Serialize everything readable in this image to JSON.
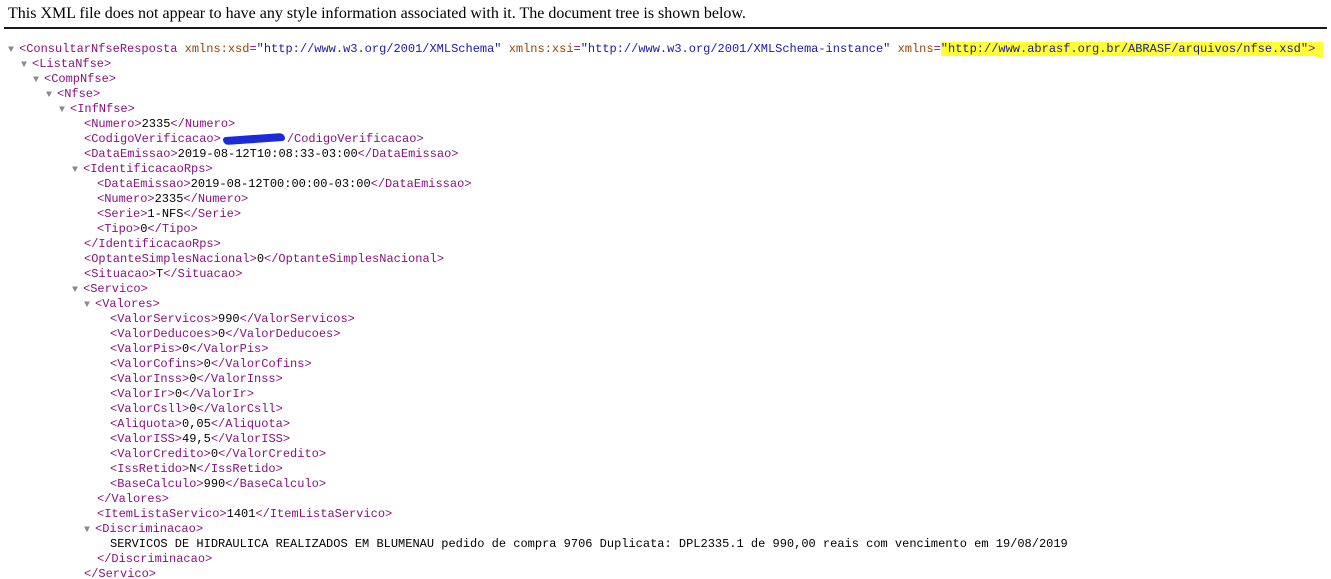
{
  "header": {
    "message": "This XML file does not appear to have any style information associated with it. The document tree is shown below."
  },
  "toggle_icon": "triangle-down-icon",
  "colors": {
    "tag": "#881280",
    "attribute_name": "#994500",
    "attribute_value": "#1a1aa6",
    "highlight": "#ffff33",
    "redaction": "#1b2bd8"
  },
  "tree": {
    "root_open": "<ConsultarNfseResposta",
    "attr1_name": "xmlns:xsd",
    "attr1_value": "\"http://www.w3.org/2001/XMLSchema\"",
    "attr2_name": "xmlns:xsi",
    "attr2_value": "\"http://www.w3.org/2001/XMLSchema-instance\"",
    "attr3_name": "xmlns",
    "attr3_value": "\"http://www.abrasf.org.br/ABRASF/arquivos/nfse.xsd\"",
    "root_open_end": ">",
    "lista_open": "<ListaNfse>",
    "comp_open": "<CompNfse>",
    "nfse_open": "<Nfse>",
    "infnfse_open": "<InfNfse>",
    "numero": {
      "open": "<Numero>",
      "value": "2335",
      "close": "</Numero>"
    },
    "codigo": {
      "open": "<CodigoVerificacao>",
      "close": "/CodigoVerificacao>"
    },
    "data_emissao": {
      "open": "<DataEmissao>",
      "value": "2019-08-12T10:08:33-03:00",
      "close": "</DataEmissao>"
    },
    "identificacao_open": "<IdentificacaoRps>",
    "rps_data": {
      "open": "<DataEmissao>",
      "value": "2019-08-12T00:00:00-03:00",
      "close": "</DataEmissao>"
    },
    "rps_numero": {
      "open": "<Numero>",
      "value": "2335",
      "close": "</Numero>"
    },
    "rps_serie": {
      "open": "<Serie>",
      "value": "1-NFS",
      "close": "</Serie>"
    },
    "rps_tipo": {
      "open": "<Tipo>",
      "value": "0",
      "close": "</Tipo>"
    },
    "identificacao_close": "</IdentificacaoRps>",
    "optante": {
      "open": "<OptanteSimplesNacional>",
      "value": "0",
      "close": "</OptanteSimplesNacional>"
    },
    "situacao": {
      "open": "<Situacao>",
      "value": "T",
      "close": "</Situacao>"
    },
    "servico_open": "<Servico>",
    "valores_open": "<Valores>",
    "valores": [
      {
        "open": "<ValorServicos>",
        "value": "990",
        "close": "</ValorServicos>"
      },
      {
        "open": "<ValorDeducoes>",
        "value": "0",
        "close": "</ValorDeducoes>"
      },
      {
        "open": "<ValorPis>",
        "value": "0",
        "close": "</ValorPis>"
      },
      {
        "open": "<ValorCofins>",
        "value": "0",
        "close": "</ValorCofins>"
      },
      {
        "open": "<ValorInss>",
        "value": "0",
        "close": "</ValorInss>"
      },
      {
        "open": "<ValorIr>",
        "value": "0",
        "close": "</ValorIr>"
      },
      {
        "open": "<ValorCsll>",
        "value": "0",
        "close": "</ValorCsll>"
      },
      {
        "open": "<Aliquota>",
        "value": "0,05",
        "close": "</Aliquota>"
      },
      {
        "open": "<ValorISS>",
        "value": "49,5",
        "close": "</ValorISS>"
      },
      {
        "open": "<ValorCredito>",
        "value": "0",
        "close": "</ValorCredito>"
      },
      {
        "open": "<IssRetido>",
        "value": "N",
        "close": "</IssRetido>"
      },
      {
        "open": "<BaseCalculo>",
        "value": "990",
        "close": "</BaseCalculo>"
      }
    ],
    "valores_close": "</Valores>",
    "item_lista": {
      "open": "<ItemListaServico>",
      "value": "1401",
      "close": "</ItemListaServico>"
    },
    "discriminacao_open": "<Discriminacao>",
    "discriminacao_text": "SERVICOS DE HIDRAULICA REALIZADOS EM BLUMENAU pedido de compra 9706 Duplicata: DPL2335.1 de 990,00 reais com vencimento em 19/08/2019",
    "discriminacao_close": "</Discriminacao>",
    "servico_close": "</Servico>"
  }
}
